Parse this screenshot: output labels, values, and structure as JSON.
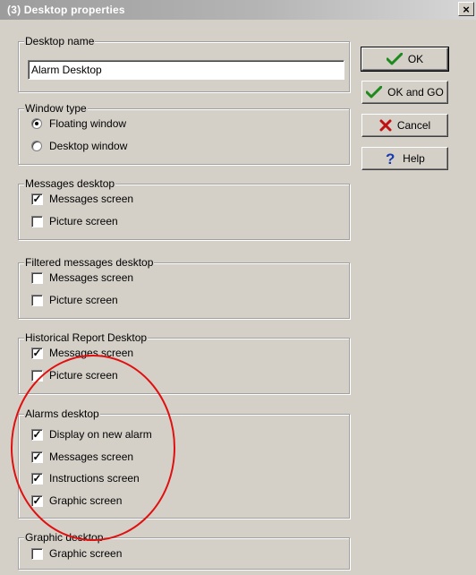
{
  "window": {
    "title": "(3) Desktop properties",
    "close_label": "×"
  },
  "buttons": {
    "ok": "OK",
    "ok_and_go": "OK and GO",
    "cancel": "Cancel",
    "help": "Help"
  },
  "desktop_name": {
    "label": "Desktop name",
    "value": "Alarm Desktop"
  },
  "window_type": {
    "label": "Window type",
    "options": [
      {
        "label": "Floating window",
        "selected": true
      },
      {
        "label": "Desktop window",
        "selected": false
      }
    ]
  },
  "messages_desktop": {
    "label": "Messages desktop",
    "items": [
      {
        "label": "Messages screen",
        "checked": true
      },
      {
        "label": "Picture screen",
        "checked": false
      }
    ]
  },
  "filtered_messages_desktop": {
    "label": "Filtered messages desktop",
    "items": [
      {
        "label": "Messages screen",
        "checked": false
      },
      {
        "label": "Picture screen",
        "checked": false
      }
    ]
  },
  "historical_report_desktop": {
    "label": "Historical Report Desktop",
    "items": [
      {
        "label": "Messages screen",
        "checked": true
      },
      {
        "label": "Picture screen",
        "checked": false
      }
    ]
  },
  "alarms_desktop": {
    "label": "Alarms desktop",
    "items": [
      {
        "label": "Display on new alarm",
        "checked": true
      },
      {
        "label": "Messages screen",
        "checked": true
      },
      {
        "label": "Instructions screen",
        "checked": true
      },
      {
        "label": "Graphic screen",
        "checked": true
      }
    ]
  },
  "graphic_desktop": {
    "label": "Graphic desktop",
    "items": [
      {
        "label": "Graphic screen",
        "checked": false
      }
    ]
  },
  "colors": {
    "highlight_circle": "#e01010",
    "check_green": "#1e8a1e",
    "cancel_red": "#c01010",
    "help_blue": "#1a3ab0"
  }
}
